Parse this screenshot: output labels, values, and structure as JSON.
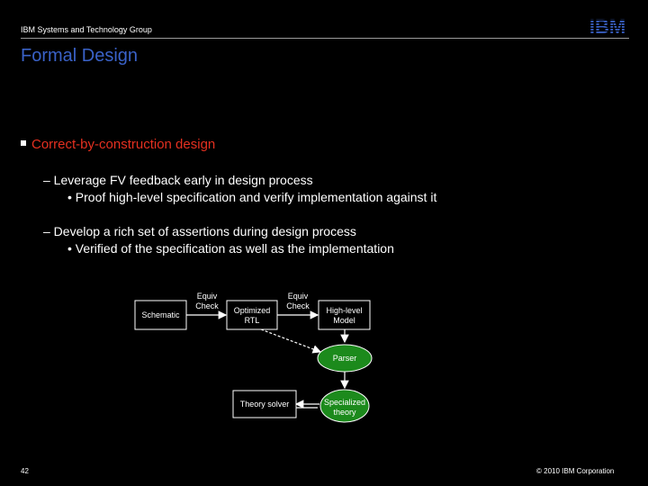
{
  "header": {
    "org": "IBM Systems and Technology Group",
    "logo_text": "IBM"
  },
  "title": "Formal Design",
  "bullets": {
    "main": "Correct-by-construction design",
    "sub1": "– Leverage FV feedback early in design process",
    "sub1_detail": "• Proof high-level specification and verify implementation against it",
    "sub2": "– Develop a rich set of assertions during design process",
    "sub2_detail": "• Verified of the specification as well as the implementation"
  },
  "diagram": {
    "schematic": "Schematic",
    "equiv1": [
      "Equiv",
      "Check"
    ],
    "optimized_rtl": [
      "Optimized",
      "RTL"
    ],
    "equiv2": [
      "Equiv",
      "Check"
    ],
    "high_level_model": [
      "High-level",
      "Model"
    ],
    "parser": "Parser",
    "theory_solver": "Theory solver",
    "specialized_theory": [
      "Specialized",
      "theory"
    ]
  },
  "colors": {
    "title": "#3a62c8",
    "bullet": "#e53020",
    "green": "#1c8a1c"
  },
  "footer": {
    "page": "42",
    "copyright": "© 2010 IBM Corporation"
  }
}
